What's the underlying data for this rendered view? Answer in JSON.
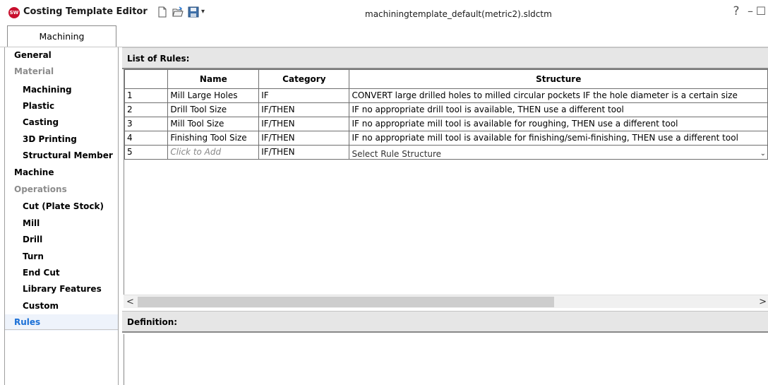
{
  "app": {
    "logo_text": "SW",
    "title": "Costing Template Editor",
    "document_title": "machiningtemplate_default(metric2).sldctm",
    "toolbar": {
      "icons": [
        "new-document-icon",
        "open-folder-icon",
        "save-icon"
      ],
      "dropdown": "▾"
    },
    "window_controls": {
      "help": "?",
      "minimize": "–",
      "maximize": "☐",
      "close": "×"
    }
  },
  "tab": {
    "label": "Machining"
  },
  "nav": {
    "items": [
      {
        "label": "General",
        "level": 1,
        "state": "normal"
      },
      {
        "label": "Material",
        "level": 1,
        "state": "disabled"
      },
      {
        "label": "Machining",
        "level": 2,
        "state": "normal"
      },
      {
        "label": "Plastic",
        "level": 2,
        "state": "normal"
      },
      {
        "label": "Casting",
        "level": 2,
        "state": "normal"
      },
      {
        "label": "3D Printing",
        "level": 2,
        "state": "normal"
      },
      {
        "label": "Structural Member",
        "level": 2,
        "state": "normal"
      },
      {
        "label": "Machine",
        "level": 1,
        "state": "normal"
      },
      {
        "label": "Operations",
        "level": 1,
        "state": "disabled"
      },
      {
        "label": "Cut (Plate Stock)",
        "level": 2,
        "state": "normal"
      },
      {
        "label": "Mill",
        "level": 2,
        "state": "normal"
      },
      {
        "label": "Drill",
        "level": 2,
        "state": "normal"
      },
      {
        "label": "Turn",
        "level": 2,
        "state": "normal"
      },
      {
        "label": "End Cut",
        "level": 2,
        "state": "normal"
      },
      {
        "label": "Library Features",
        "level": 2,
        "state": "normal"
      },
      {
        "label": "Custom",
        "level": 2,
        "state": "normal"
      },
      {
        "label": "Rules",
        "level": 1,
        "state": "active"
      }
    ]
  },
  "rules": {
    "header": "List of Rules:",
    "columns": {
      "num": "",
      "name": "Name",
      "category": "Category",
      "structure": "Structure"
    },
    "rows": [
      {
        "num": "1",
        "name": "Mill Large Holes",
        "category": "IF",
        "structure": "CONVERT large drilled holes to milled circular pockets IF the hole diameter is a certain size"
      },
      {
        "num": "2",
        "name": "Drill Tool Size",
        "category": "IF/THEN",
        "structure": "IF no appropriate drill tool is available, THEN use a different tool"
      },
      {
        "num": "3",
        "name": "Mill Tool Size",
        "category": "IF/THEN",
        "structure": "IF no appropriate mill tool is available for roughing, THEN use a different tool"
      },
      {
        "num": "4",
        "name": "Finishing Tool Size",
        "category": "IF/THEN",
        "structure": "IF no appropriate mill tool is available for finishing/semi-finishing, THEN use a different tool"
      }
    ],
    "new_row": {
      "num": "5",
      "name_placeholder": "Click to Add",
      "category": "IF/THEN",
      "structure_select": "Select Rule Structure"
    }
  },
  "scrollbar": {
    "left_arrow": "<",
    "right_arrow": ">"
  },
  "definition": {
    "header": "Definition:"
  }
}
